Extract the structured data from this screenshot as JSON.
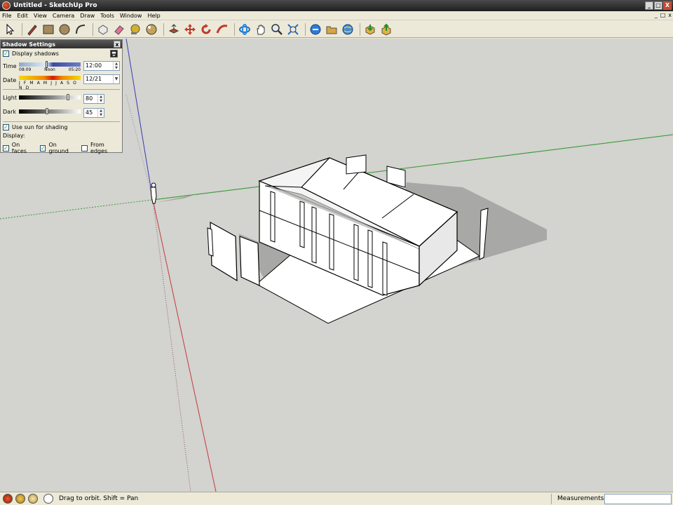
{
  "window": {
    "title": "Untitled - SketchUp Pro",
    "minimize": "_",
    "restore": "□",
    "close": "X"
  },
  "menu": {
    "items": [
      "File",
      "Edit",
      "View",
      "Camera",
      "Draw",
      "Tools",
      "Window",
      "Help"
    ],
    "right_controls": [
      "_",
      "□",
      "x"
    ]
  },
  "toolbar": {
    "tools": [
      "select",
      "pencil",
      "rectangle",
      "circle",
      "arc",
      "eraser-shape",
      "eraser",
      "tape-measure",
      "paint-bucket",
      "push-pull",
      "move",
      "rotate",
      "follow-me",
      "orbit",
      "pan",
      "zoom",
      "zoom-extents",
      "previous-view",
      "next-view",
      "standard-views",
      "get-models",
      "share-model"
    ]
  },
  "shadow_panel": {
    "title": "Shadow Settings",
    "close": "x",
    "display_shadows_label": "Display shadows",
    "display_shadows_checked": true,
    "time_label": "Time",
    "time_ticks": [
      "08:09",
      "Noon",
      "05:20"
    ],
    "time_value": "12:00",
    "date_label": "Date",
    "date_months": "J F M A M J J A S O N D",
    "date_value": "12/21",
    "light_label": "Light",
    "light_value": "80",
    "light_level": 0.8,
    "dark_label": "Dark",
    "dark_value": "45",
    "dark_level": 0.45,
    "use_sun_label": "Use sun for shading",
    "use_sun_checked": true,
    "display_label": "Display:",
    "on_faces_label": "On faces",
    "on_faces_checked": true,
    "on_ground_label": "On ground",
    "on_ground_checked": true,
    "from_edges_label": "From edges",
    "from_edges_checked": false
  },
  "status": {
    "hint": "Drag to orbit.  Shift = Pan",
    "measurements_label": "Measurements",
    "measurements_value": ""
  },
  "colors": {
    "viewport_bg": "#d3d3cf",
    "axis_red": "#c43a3a",
    "axis_green": "#3a9a3a",
    "axis_blue": "#3a3ab0",
    "shadow": "#a8a8a6",
    "face": "#ffffff"
  }
}
